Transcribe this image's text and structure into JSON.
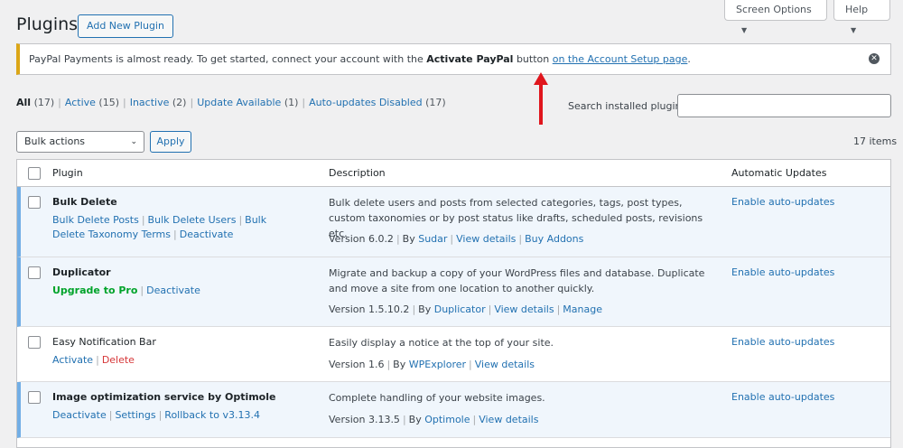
{
  "header": {
    "title": "Plugins",
    "add_new_label": "Add New Plugin",
    "screen_options_label": "Screen Options",
    "help_label": "Help"
  },
  "notice": {
    "text_before": "PayPal Payments is almost ready. To get started, connect your account with the ",
    "bold_text": "Activate PayPal",
    "text_middle": " button ",
    "link_text": "on the Account Setup page",
    "text_after": "."
  },
  "filters": [
    {
      "label": "All",
      "count": "(17)",
      "current": true
    },
    {
      "label": "Active",
      "count": "(15)",
      "current": false
    },
    {
      "label": "Inactive",
      "count": "(2)",
      "current": false
    },
    {
      "label": "Update Available",
      "count": "(1)",
      "current": false
    },
    {
      "label": "Auto-updates Disabled",
      "count": "(17)",
      "current": false
    }
  ],
  "search": {
    "label": "Search installed plugins",
    "value": ""
  },
  "bulk": {
    "selected": "Bulk actions",
    "apply_label": "Apply"
  },
  "item_count": "17 items",
  "table": {
    "columns": [
      "Plugin",
      "Description",
      "Automatic Updates"
    ],
    "rows": [
      {
        "name": "Bulk Delete",
        "status": "active",
        "actions": [
          {
            "label": "Bulk Delete Posts",
            "type": "link"
          },
          {
            "label": "Bulk Delete Users",
            "type": "link"
          },
          {
            "label": "Bulk Delete Taxonomy Terms",
            "type": "link"
          },
          {
            "label": "Deactivate",
            "type": "link"
          }
        ],
        "description": "Bulk delete users and posts from selected categories, tags, post types, custom taxonomies or by post status like drafts, scheduled posts, revisions etc.",
        "version": "Version 6.0.2",
        "by": "By",
        "author": "Sudar",
        "meta_links": [
          "View details",
          "Buy Addons"
        ],
        "auto_update": "Enable auto-updates"
      },
      {
        "name": "Duplicator",
        "status": "active",
        "actions": [
          {
            "label": "Upgrade to Pro",
            "type": "upgrade"
          },
          {
            "label": "Deactivate",
            "type": "link"
          }
        ],
        "description": "Migrate and backup a copy of your WordPress files and database. Duplicate and move a site from one location to another quickly.",
        "version": "Version 1.5.10.2",
        "by": "By",
        "author": "Duplicator",
        "meta_links": [
          "View details",
          "Manage"
        ],
        "auto_update": "Enable auto-updates"
      },
      {
        "name": "Easy Notification Bar",
        "status": "inactive",
        "actions": [
          {
            "label": "Activate",
            "type": "link"
          },
          {
            "label": "Delete",
            "type": "delete"
          }
        ],
        "description": "Easily display a notice at the top of your site.",
        "version": "Version 1.6",
        "by": "By",
        "author": "WPExplorer",
        "meta_links": [
          "View details"
        ],
        "auto_update": "Enable auto-updates"
      },
      {
        "name": "Image optimization service by Optimole",
        "status": "active",
        "actions": [
          {
            "label": "Deactivate",
            "type": "link"
          },
          {
            "label": "Settings",
            "type": "link"
          },
          {
            "label": "Rollback to v3.13.4",
            "type": "link"
          }
        ],
        "description": "Complete handling of your website images.",
        "version": "Version 3.13.5",
        "by": "By",
        "author": "Optimole",
        "meta_links": [
          "View details"
        ],
        "auto_update": "Enable auto-updates"
      }
    ]
  },
  "colors": {
    "accent": "#2271b1",
    "notice_border": "#dba617",
    "active_row_bg": "#f0f6fc",
    "active_row_border": "#72aee6",
    "arrow": "#e0161d",
    "upgrade": "#00a32a",
    "delete": "#d63638"
  }
}
